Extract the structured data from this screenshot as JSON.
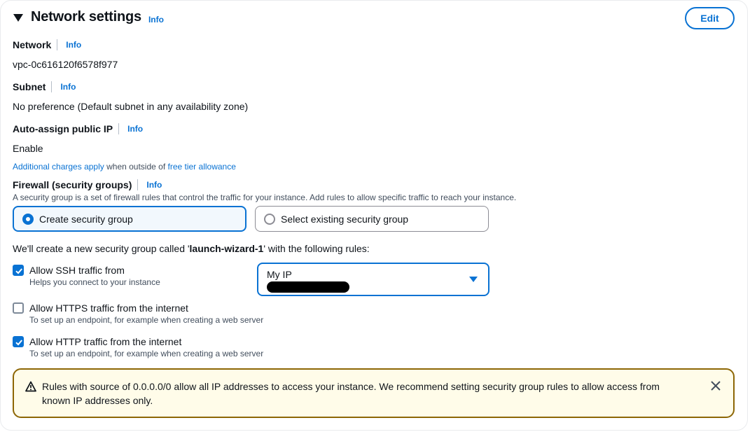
{
  "header": {
    "title": "Network settings",
    "info_label": "Info",
    "edit_label": "Edit"
  },
  "network": {
    "label": "Network",
    "info_label": "Info",
    "value": "vpc-0c616120f6578f977"
  },
  "subnet": {
    "label": "Subnet",
    "info_label": "Info",
    "value": "No preference (Default subnet in any availability zone)"
  },
  "auto_ip": {
    "label": "Auto-assign public IP",
    "info_label": "Info",
    "value": "Enable"
  },
  "charges": {
    "link1": "Additional charges apply",
    "middle": " when outside of ",
    "link2": "free tier allowance"
  },
  "firewall": {
    "label": "Firewall (security groups)",
    "info_label": "Info",
    "description": "A security group is a set of firewall rules that control the traffic for your instance. Add rules to allow specific traffic to reach your instance.",
    "options": [
      {
        "label": "Create security group",
        "selected": true
      },
      {
        "label": "Select existing security group",
        "selected": false
      }
    ]
  },
  "create_text": {
    "prefix": "We'll create a new security group called '",
    "name": "launch-wizard-1",
    "suffix": "' with the following rules:"
  },
  "rules": [
    {
      "label": "Allow SSH traffic from",
      "description": "Helps you connect to your instance",
      "checked": true
    },
    {
      "label": "Allow HTTPS traffic from the internet",
      "description": "To set up an endpoint, for example when creating a web server",
      "checked": false
    },
    {
      "label": "Allow HTTP traffic from the internet",
      "description": "To set up an endpoint, for example when creating a web server",
      "checked": true
    }
  ],
  "ssh_source": {
    "value": "My IP"
  },
  "alert": {
    "text": "Rules with source of 0.0.0.0/0 allow all IP addresses to access your instance. We recommend setting security group rules to allow access from known IP addresses only.",
    "icon": "warning-icon"
  },
  "colors": {
    "accent": "#0972d3",
    "warning_border": "#8d6605",
    "warning_bg": "#fffce9"
  }
}
